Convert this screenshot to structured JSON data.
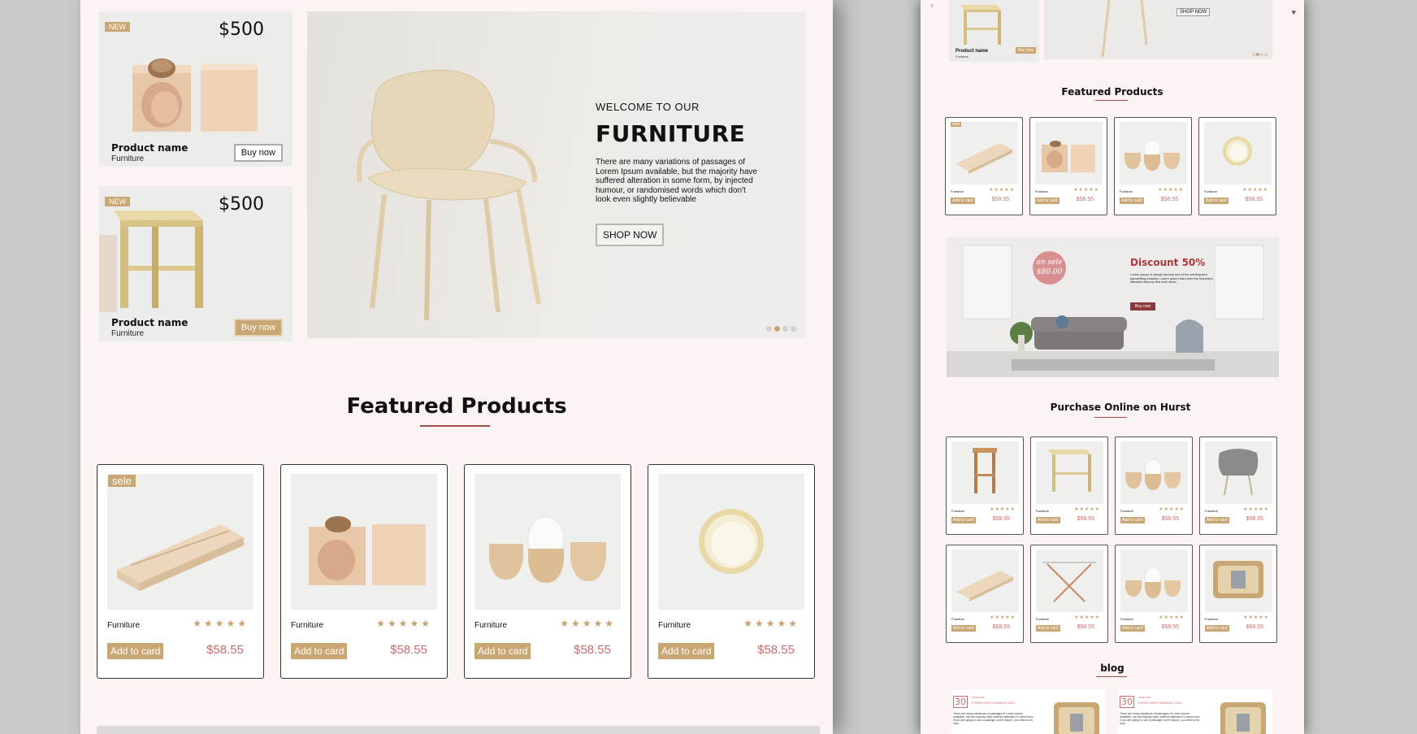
{
  "colors": {
    "background": "#c9c9c9",
    "page": "#fbf4f3",
    "gold": "#c8a774",
    "price": "#c96c6c",
    "accent_line": "#a24c4c",
    "discount": "#a7393b"
  },
  "left": {
    "side_products": [
      {
        "badge": "NEW",
        "price": "$500",
        "name": "Product name",
        "category": "Furniture",
        "button": "Buy now",
        "style": "outline"
      },
      {
        "badge": "NEW",
        "price": "$500",
        "name": "Product name",
        "category": "Furniture",
        "button": "Buy now",
        "style": "gold"
      }
    ],
    "hero": {
      "welcome": "WELCOME TO OUR",
      "title": "FURNITURE",
      "description": "There are many variations of passages of Lorem Ipsum available, but the majority have suffered alteration in some form, by injected humour, or randomised words which don't look even slightly believable",
      "button": "SHOP NOW",
      "slide_count": 4,
      "active_slide": 2
    },
    "featured": {
      "title": "Featured Products",
      "products": [
        {
          "image": "tray",
          "sale": "sele",
          "category": "Furniture",
          "stars": "★★★★★",
          "button": "Add to card",
          "price": "$58.55"
        },
        {
          "image": "blocks",
          "sale": "",
          "category": "Furniture",
          "stars": "★★★★★",
          "button": "Add to card",
          "price": "$58.55"
        },
        {
          "image": "egg-cups",
          "sale": "",
          "category": "Furniture",
          "stars": "★★★★★",
          "button": "Add to card",
          "price": "$58.55"
        },
        {
          "image": "bowl",
          "sale": "",
          "category": "Furniture",
          "stars": "★★★★★",
          "button": "Add to card",
          "price": "$58.55"
        }
      ]
    }
  },
  "right": {
    "menu_icon": "≡",
    "heart_icon": "♥",
    "top_product": {
      "name": "Product name",
      "category": "Furniture",
      "button": "Buy now"
    },
    "top_hero_button": "SHOP NOW",
    "featured_title": "Featured Products",
    "featured_cards": [
      {
        "image": "tray",
        "sale": "sele",
        "category": "Furniture",
        "stars": "★★★★★",
        "button": "Add to card",
        "price": "$58.55"
      },
      {
        "image": "blocks",
        "sale": "",
        "category": "Furniture",
        "stars": "★★★★★",
        "button": "Add to card",
        "price": "$58.55"
      },
      {
        "image": "egg-cups",
        "sale": "",
        "category": "Furniture",
        "stars": "★★★★★",
        "button": "Add to card",
        "price": "$58.55"
      },
      {
        "image": "bowl",
        "sale": "",
        "category": "Furniture",
        "stars": "★★★★★",
        "button": "Add to card",
        "price": "$58.55"
      }
    ],
    "banner": {
      "sale_line1": "on sele",
      "sale_line2": "$80.00",
      "title": "Discount 50%",
      "text": "Lorem Ipsum is simply dummy text of the printing and typesetting industry. Lorem Ipsum has been the industry's standard dummy text ever since.",
      "button": "Buy now"
    },
    "purchase_title": "Purchase Online on Hurst",
    "purchase_cards": [
      {
        "image": "stool",
        "category": "Furniture",
        "stars": "★★★★★",
        "button": "Add to card",
        "price": "$58.55"
      },
      {
        "image": "side-table",
        "category": "Furniture",
        "stars": "★★★★★",
        "button": "Add to card",
        "price": "$58.55"
      },
      {
        "image": "egg-cups",
        "category": "Furniture",
        "stars": "★★★★★",
        "button": "Add to card",
        "price": "$58.55"
      },
      {
        "image": "grey-chair",
        "category": "Furniture",
        "stars": "★★★★★",
        "button": "Add to card",
        "price": "$58.55"
      },
      {
        "image": "tray",
        "category": "Furniture",
        "stars": "★★★★★",
        "button": "Add to card",
        "price": "$58.55"
      },
      {
        "image": "folding-table",
        "category": "Furniture",
        "stars": "★★★★★",
        "button": "Add to card",
        "price": "$58.55"
      },
      {
        "image": "egg-cups",
        "category": "Furniture",
        "stars": "★★★★★",
        "button": "Add to card",
        "price": "$58.55"
      },
      {
        "image": "wood-box",
        "category": "Furniture",
        "stars": "★★★★★",
        "button": "Add to card",
        "price": "$58.55"
      }
    ],
    "blog_title": "blog",
    "blog_posts": [
      {
        "day": "30",
        "meta": "JUNE 2025",
        "headline": "FURNITURE DRAWING 2025",
        "text": "There are many variations of passages of Lorem Ipsum available, but the majority have suffered alteration in some form. If you are going to use a passage Lorem Ipsum, you need to be sure."
      },
      {
        "day": "30",
        "meta": "JUNE 2025",
        "headline": "FURNITURE DRAWING 2025",
        "text": "There are many variations of passages of Lorem Ipsum available, but the majority have suffered alteration in some form. If you are going to use a passage Lorem Ipsum, you need to be sure."
      }
    ]
  }
}
